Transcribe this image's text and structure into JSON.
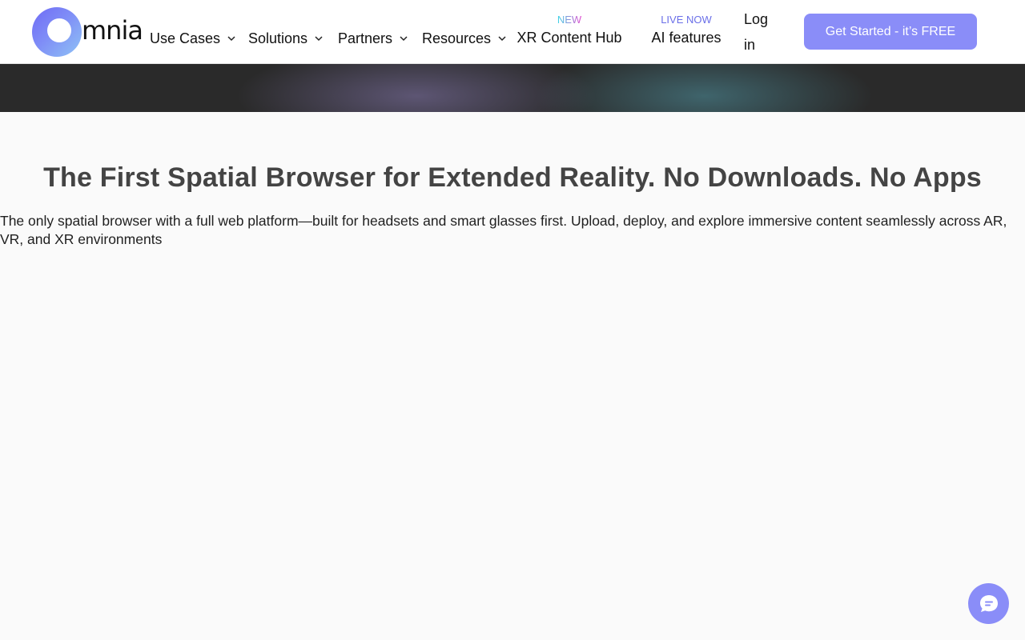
{
  "brand": {
    "logo_text": "mnia"
  },
  "nav": {
    "items": [
      {
        "label": "Use Cases"
      },
      {
        "label": "Solutions"
      },
      {
        "label": "Partners"
      },
      {
        "label": "Resources"
      }
    ],
    "xr_hub": {
      "kicker": "NEW",
      "label": "XR Content Hub"
    },
    "ai": {
      "kicker": "LIVE NOW",
      "label": "AI features"
    },
    "login_label": "Log in",
    "cta_label": "Get Started - it’s FREE"
  },
  "hero": {
    "title": "The First Spatial Browser for Extended Reality. No Downloads. No Apps",
    "subtitle": "The only spatial browser with a full web platform—built for headsets and smart glasses first. Upload, deploy, and explore immersive content seamlessly across AR, VR, and XR environments"
  },
  "colors": {
    "accent": "#8a8df8",
    "title_text": "#444444"
  },
  "icons": {
    "chevron": "chevron-down-icon",
    "chat": "chat-bubble-icon"
  }
}
